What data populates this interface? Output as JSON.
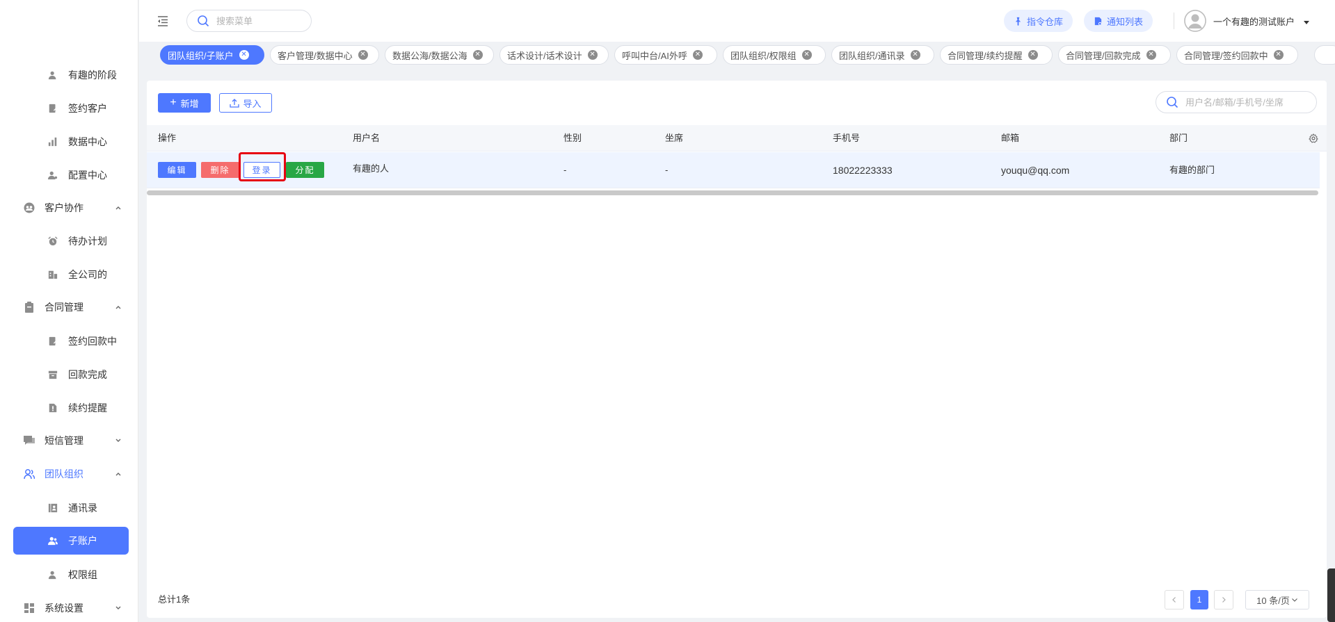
{
  "sidebar": {
    "items": [
      {
        "label": "有趣的阶段",
        "type": "sub",
        "icon": "person-icon"
      },
      {
        "label": "签约客户",
        "type": "sub",
        "icon": "document-edit-icon"
      },
      {
        "label": "数据中心",
        "type": "sub",
        "icon": "bar-chart-icon"
      },
      {
        "label": "配置中心",
        "type": "sub",
        "icon": "person-settings-icon"
      },
      {
        "label": "客户协作",
        "type": "group",
        "icon": "users-circle-icon",
        "expanded": true
      },
      {
        "label": "待办计划",
        "type": "sub",
        "icon": "alarm-clock-icon"
      },
      {
        "label": "全公司的",
        "type": "sub",
        "icon": "building-icon"
      },
      {
        "label": "合同管理",
        "type": "group",
        "icon": "clipboard-icon",
        "expanded": true
      },
      {
        "label": "签约回款中",
        "type": "sub",
        "icon": "document-edit-icon"
      },
      {
        "label": "回款完成",
        "type": "sub",
        "icon": "archive-icon"
      },
      {
        "label": "续约提醒",
        "type": "sub",
        "icon": "file-alert-icon"
      },
      {
        "label": "短信管理",
        "type": "group",
        "icon": "chat-icon",
        "expanded": false
      },
      {
        "label": "团队组织",
        "type": "group",
        "icon": "team-icon",
        "expanded": true,
        "active_group": true
      },
      {
        "label": "通讯录",
        "type": "sub",
        "icon": "contacts-icon"
      },
      {
        "label": "子账户",
        "type": "sub",
        "icon": "sub-account-icon",
        "active": true
      },
      {
        "label": "权限组",
        "type": "sub",
        "icon": "person-icon"
      },
      {
        "label": "系统设置",
        "type": "group",
        "icon": "dashboard-icon",
        "expanded": false
      }
    ]
  },
  "header": {
    "search_placeholder": "搜索菜单",
    "command_library": "指令仓库",
    "notice_list": "通知列表",
    "username": "一个有趣的测试账户"
  },
  "tags": [
    {
      "label": "团队组织/子账户",
      "active": true
    },
    {
      "label": "客户管理/数据中心"
    },
    {
      "label": "数据公海/数据公海"
    },
    {
      "label": "话术设计/话术设计"
    },
    {
      "label": "呼叫中台/AI外呼"
    },
    {
      "label": "团队组织/权限组"
    },
    {
      "label": "团队组织/通讯录"
    },
    {
      "label": "合同管理/续约提醒"
    },
    {
      "label": "合同管理/回款完成"
    },
    {
      "label": "合同管理/签约回款中"
    }
  ],
  "toolbar": {
    "add_label": "新增",
    "import_label": "导入",
    "search_placeholder": "用户名/邮箱/手机号/坐席"
  },
  "table": {
    "columns": [
      "操作",
      "用户名",
      "性别",
      "坐席",
      "手机号",
      "邮箱",
      "部门"
    ],
    "rows": [
      {
        "actions": [
          "编辑",
          "删除",
          "登录",
          "分配"
        ],
        "username": "有趣的人",
        "gender": "-",
        "seat": "-",
        "phone": "18022223333",
        "email": "youqu@qq.com",
        "department": "有趣的部门"
      }
    ]
  },
  "footer": {
    "total": "总计1条",
    "current_page": "1",
    "page_size": "10 条/页"
  },
  "colors": {
    "primary": "#4e78ff",
    "danger": "#f56c6c",
    "success": "#28a745",
    "highlight": "#e60012"
  }
}
